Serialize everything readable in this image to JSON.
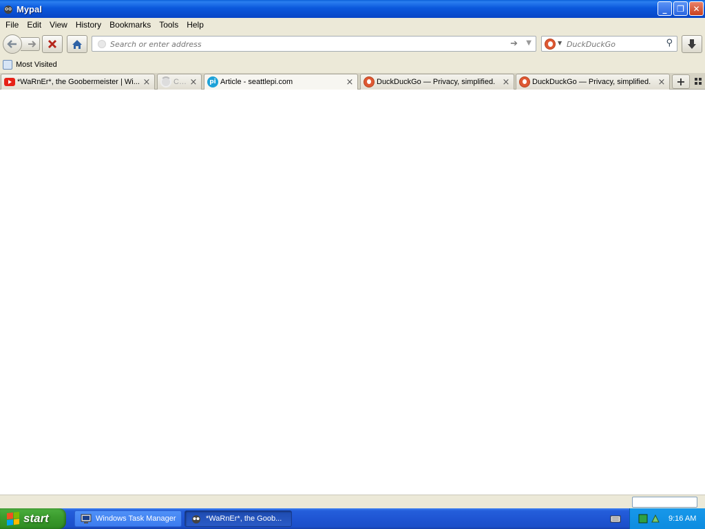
{
  "window": {
    "title": "Mypal",
    "buttons": {
      "minimize": "_",
      "restore": "❐",
      "close": "✕"
    }
  },
  "menu": {
    "items": [
      "File",
      "Edit",
      "View",
      "History",
      "Bookmarks",
      "Tools",
      "Help"
    ]
  },
  "nav": {
    "url_placeholder": "Search or enter address",
    "url_value": "",
    "search_engine": "DuckDuckGo",
    "search_placeholder": "DuckDuckGo"
  },
  "bookmarks": {
    "items": [
      {
        "label": "Most Visited"
      }
    ]
  },
  "tabs": [
    {
      "title": "*WaRnEr*, the Goobermeister | Wi...",
      "favicon": "youtube-icon"
    },
    {
      "title": "Co...",
      "favicon": "loading-icon"
    },
    {
      "title": "Article - seattlepi.com",
      "favicon": "seattlepi-icon"
    },
    {
      "title": "DuckDuckGo — Privacy, simplified.",
      "favicon": "duckduckgo-icon"
    },
    {
      "title": "DuckDuckGo — Privacy, simplified.",
      "favicon": "duckduckgo-icon"
    }
  ],
  "taskbar": {
    "start_label": "start",
    "tasks": [
      {
        "label": "Windows Task Manager",
        "icon": "task-manager-icon"
      },
      {
        "label": "*WaRnEr*, the Goob...",
        "icon": "mypal-icon"
      }
    ],
    "clock": "9:16 AM"
  }
}
